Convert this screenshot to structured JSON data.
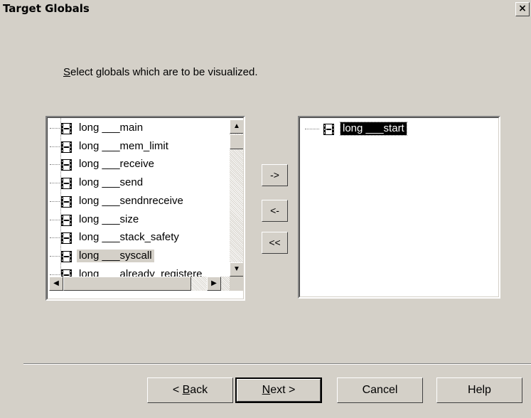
{
  "window": {
    "title": "Target Globals",
    "close_glyph": "×"
  },
  "instruction": {
    "mnemonic": "S",
    "rest": "elect globals which are to be visualized."
  },
  "left_list": {
    "items": [
      {
        "type": "long",
        "name": "___main"
      },
      {
        "type": "long",
        "name": "___mem_limit"
      },
      {
        "type": "long",
        "name": "___receive"
      },
      {
        "type": "long",
        "name": "___send"
      },
      {
        "type": "long",
        "name": "___sendnreceive"
      },
      {
        "type": "long",
        "name": "___size"
      },
      {
        "type": "long",
        "name": "___stack_safety"
      },
      {
        "type": "long",
        "name": "___syscall"
      },
      {
        "type": "long",
        "name": "___already_registere"
      }
    ],
    "selected_index": 7,
    "icon": "film-icon",
    "scroll_up_glyph": "▲",
    "scroll_down_glyph": "▼",
    "scroll_left_glyph": "◀",
    "scroll_right_glyph": "▶"
  },
  "right_list": {
    "items": [
      {
        "label": "long ___start"
      }
    ],
    "focused_index": 0
  },
  "move_buttons": {
    "add": "->",
    "remove": "<-",
    "remove_all": "<<"
  },
  "buttons": {
    "back": {
      "prefix": "< ",
      "mnemonic": "B",
      "rest": "ack"
    },
    "next": {
      "mnemonic": "N",
      "rest": "ext >"
    },
    "cancel": "Cancel",
    "help": "Help"
  }
}
